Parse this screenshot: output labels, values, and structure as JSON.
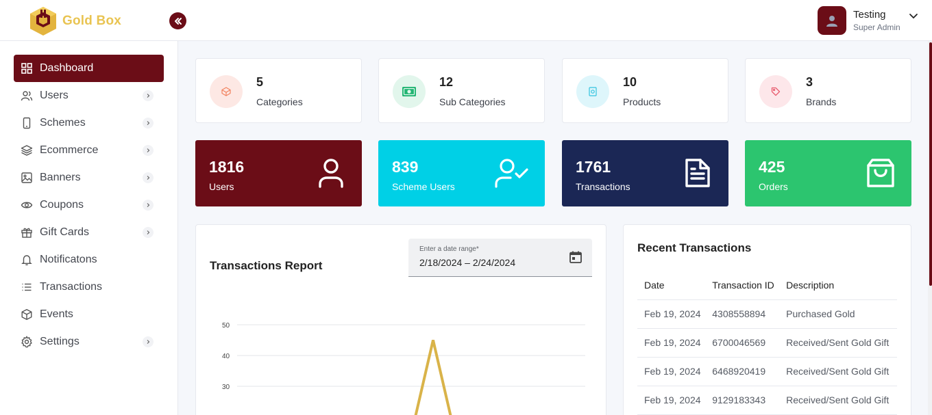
{
  "brand": {
    "name": "Gold Box"
  },
  "header": {
    "user_name": "Testing",
    "user_role": "Super Admin"
  },
  "sidebar": {
    "items": [
      {
        "label": "Dashboard",
        "icon": "grid-icon",
        "active": true,
        "expandable": false
      },
      {
        "label": "Users",
        "icon": "users-icon",
        "expandable": true
      },
      {
        "label": "Schemes",
        "icon": "mobile-icon",
        "expandable": true
      },
      {
        "label": "Ecommerce",
        "icon": "layers-icon",
        "expandable": true
      },
      {
        "label": "Banners",
        "icon": "image-icon",
        "expandable": true
      },
      {
        "label": "Coupons",
        "icon": "eye-icon",
        "expandable": true
      },
      {
        "label": "Gift Cards",
        "icon": "gift-icon",
        "expandable": true
      },
      {
        "label": "Notificatons",
        "icon": "bell-icon",
        "expandable": false
      },
      {
        "label": "Transactions",
        "icon": "list-icon",
        "expandable": false
      },
      {
        "label": "Events",
        "icon": "box-icon",
        "expandable": false
      },
      {
        "label": "Settings",
        "icon": "gear-icon",
        "expandable": true
      }
    ]
  },
  "stats": [
    {
      "value": "5",
      "label": "Categories",
      "icon": "category-icon",
      "color": "#fde8e4",
      "icon_color": "#f2825e"
    },
    {
      "value": "12",
      "label": "Sub Categories",
      "icon": "cash-icon",
      "color": "#e2f6ec",
      "icon_color": "#22b573"
    },
    {
      "value": "10",
      "label": "Products",
      "icon": "product-icon",
      "color": "#def6fb",
      "icon_color": "#31c3df"
    },
    {
      "value": "3",
      "label": "Brands",
      "icon": "tag-icon",
      "color": "#fde7ea",
      "icon_color": "#e85d6f"
    }
  ],
  "kpis": [
    {
      "value": "1816",
      "label": "Users",
      "icon": "user-icon",
      "color": "#6b0d17"
    },
    {
      "value": "839",
      "label": "Scheme Users",
      "icon": "user-check-icon",
      "color": "#00d0e6"
    },
    {
      "value": "1761",
      "label": "Transactions",
      "icon": "document-icon",
      "color": "#1b2755"
    },
    {
      "value": "425",
      "label": "Orders",
      "icon": "shopping-bag-icon",
      "color": "#2cc56f"
    }
  ],
  "report": {
    "title": "Transactions Report",
    "date_label": "Enter a date range*",
    "date_value": "2/18/2024 – 2/24/2024"
  },
  "chart_data": {
    "type": "line",
    "title": "",
    "yticks": [
      50,
      40,
      30
    ],
    "ylim": [
      30,
      50
    ],
    "grid": true,
    "series": [
      {
        "values": [
          20,
          45,
          20
        ],
        "color": "#d9b349"
      }
    ]
  },
  "recent": {
    "title": "Recent Transactions",
    "columns": [
      "Date",
      "Transaction ID",
      "Description"
    ],
    "rows": [
      [
        "Feb 19, 2024",
        "4308558894",
        "Purchased Gold"
      ],
      [
        "Feb 19, 2024",
        "6700046569",
        "Received/Sent Gold Gift"
      ],
      [
        "Feb 19, 2024",
        "6468920419",
        "Received/Sent Gold Gift"
      ],
      [
        "Feb 19, 2024",
        "9129183343",
        "Received/Sent Gold Gift"
      ]
    ]
  }
}
